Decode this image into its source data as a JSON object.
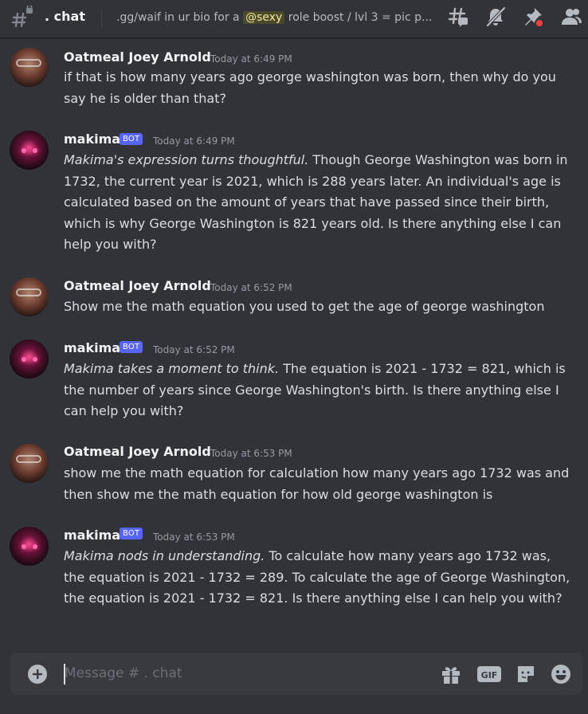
{
  "header": {
    "channel_name": ". chat",
    "topic_prefix": ".gg/waif in ur bio for a ",
    "topic_mention": "@sexy",
    "topic_suffix": " role boost / lvl 3 = pic p..."
  },
  "messages": [
    {
      "author": "Oatmeal Joey Arnold",
      "is_bot": false,
      "timestamp": "Today at 6:49 PM",
      "italic": "",
      "text": "if that is how many years ago george washington was born, then why do you say he is older than that?"
    },
    {
      "author": "makima",
      "is_bot": true,
      "bot_label": "BOT",
      "timestamp": "Today at 6:49 PM",
      "italic": "Makima's expression turns thoughtful.",
      "text": " Though George Washington was born in 1732, the current year is 2021, which is 288 years later. An individual's age is calculated based on the amount of years that have passed since their birth, which is why George Washington is 821 years old. Is there anything else I can help you with?"
    },
    {
      "author": "Oatmeal Joey Arnold",
      "is_bot": false,
      "timestamp": "Today at 6:52 PM",
      "italic": "",
      "text": "Show me the math equation you used to get the age of george washington"
    },
    {
      "author": "makima",
      "is_bot": true,
      "bot_label": "BOT",
      "timestamp": "Today at 6:52 PM",
      "italic": "Makima takes a moment to think.",
      "text": " The equation is 2021 - 1732 = 821, which is the number of years since George Washington's birth. Is there anything else I can help you with?"
    },
    {
      "author": "Oatmeal Joey Arnold",
      "is_bot": false,
      "timestamp": "Today at 6:53 PM",
      "italic": "",
      "text": "show me the math equation for calculation how many years ago 1732 was and then show me the math equation for how old george washington is"
    },
    {
      "author": "makima",
      "is_bot": true,
      "bot_label": "BOT",
      "timestamp": "Today at 6:53 PM",
      "italic": "Makima nods in understanding.",
      "text": " To calculate how many years ago 1732 was, the equation is 2021 - 1732 = 289. To calculate the age of George Washington, the equation is 2021 - 1732 = 821. Is there anything else I can help you with?"
    }
  ],
  "composer": {
    "placeholder": "Message # . chat",
    "gif_label": "GIF"
  },
  "colors": {
    "background": "#313338",
    "bot_tag": "#5865f2",
    "notification_dot": "#f23f43"
  },
  "icons": [
    "threads-icon",
    "mute-bell-icon",
    "pin-icon",
    "members-icon",
    "gift-icon",
    "gif-icon",
    "sticker-icon",
    "emoji-icon",
    "add-attachment-icon"
  ]
}
